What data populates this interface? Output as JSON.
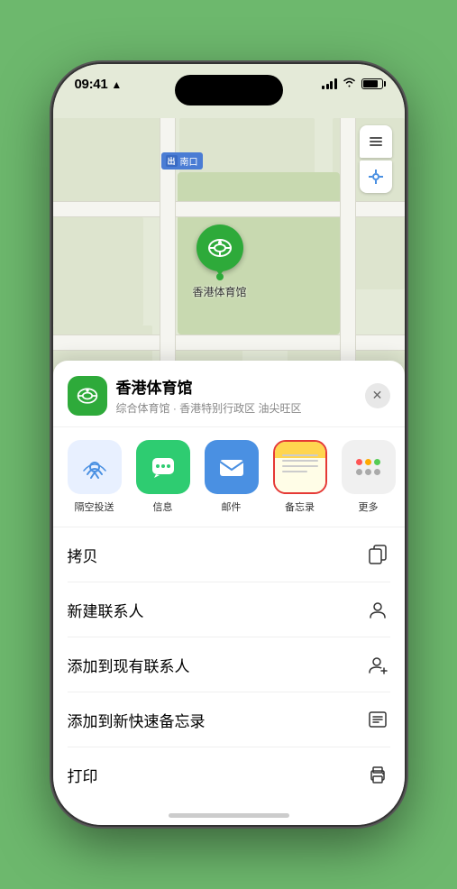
{
  "statusBar": {
    "time": "09:41",
    "locationArrow": "▶"
  },
  "map": {
    "label": "南口",
    "controls": [
      "map-layers",
      "location"
    ]
  },
  "pin": {
    "name": "香港体育馆"
  },
  "bottomSheet": {
    "venueName": "香港体育馆",
    "venueSubtitle": "综合体育馆 · 香港特别行政区 油尖旺区",
    "closeLabel": "✕",
    "shareItems": [
      {
        "id": "airdrop",
        "label": "隔空投送"
      },
      {
        "id": "message",
        "label": "信息"
      },
      {
        "id": "mail",
        "label": "邮件"
      },
      {
        "id": "notes",
        "label": "备忘录"
      },
      {
        "id": "more",
        "label": "更多"
      }
    ],
    "actions": [
      {
        "id": "copy",
        "label": "拷贝"
      },
      {
        "id": "new-contact",
        "label": "新建联系人"
      },
      {
        "id": "add-contact",
        "label": "添加到现有联系人"
      },
      {
        "id": "quick-note",
        "label": "添加到新快速备忘录"
      },
      {
        "id": "print",
        "label": "打印"
      }
    ]
  }
}
